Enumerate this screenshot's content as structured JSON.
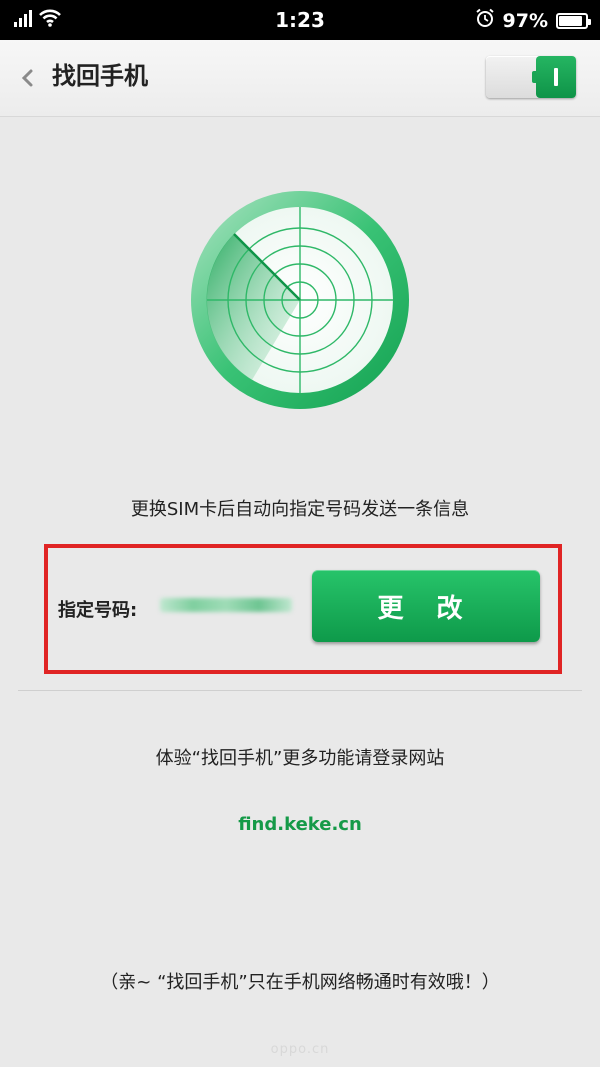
{
  "status_bar": {
    "time": "1:23",
    "battery": "97%",
    "battery_level": 0.97
  },
  "header": {
    "title": "找回手机",
    "toggle_state": "on"
  },
  "description": "更换SIM卡后自动向指定号码发送一条信息",
  "phone": {
    "label": "指定号码:",
    "change_button": "更 改"
  },
  "promo_text": "体验“找回手机”更多功能请登录网站",
  "link_text": "find.keke.cn",
  "note_text": "（亲~ “找回手机”只在手机网络畅通时有效哦！）",
  "watermark": "oppo.cn",
  "colors": {
    "accent": "#159a48",
    "highlight_box": "#e02424"
  }
}
